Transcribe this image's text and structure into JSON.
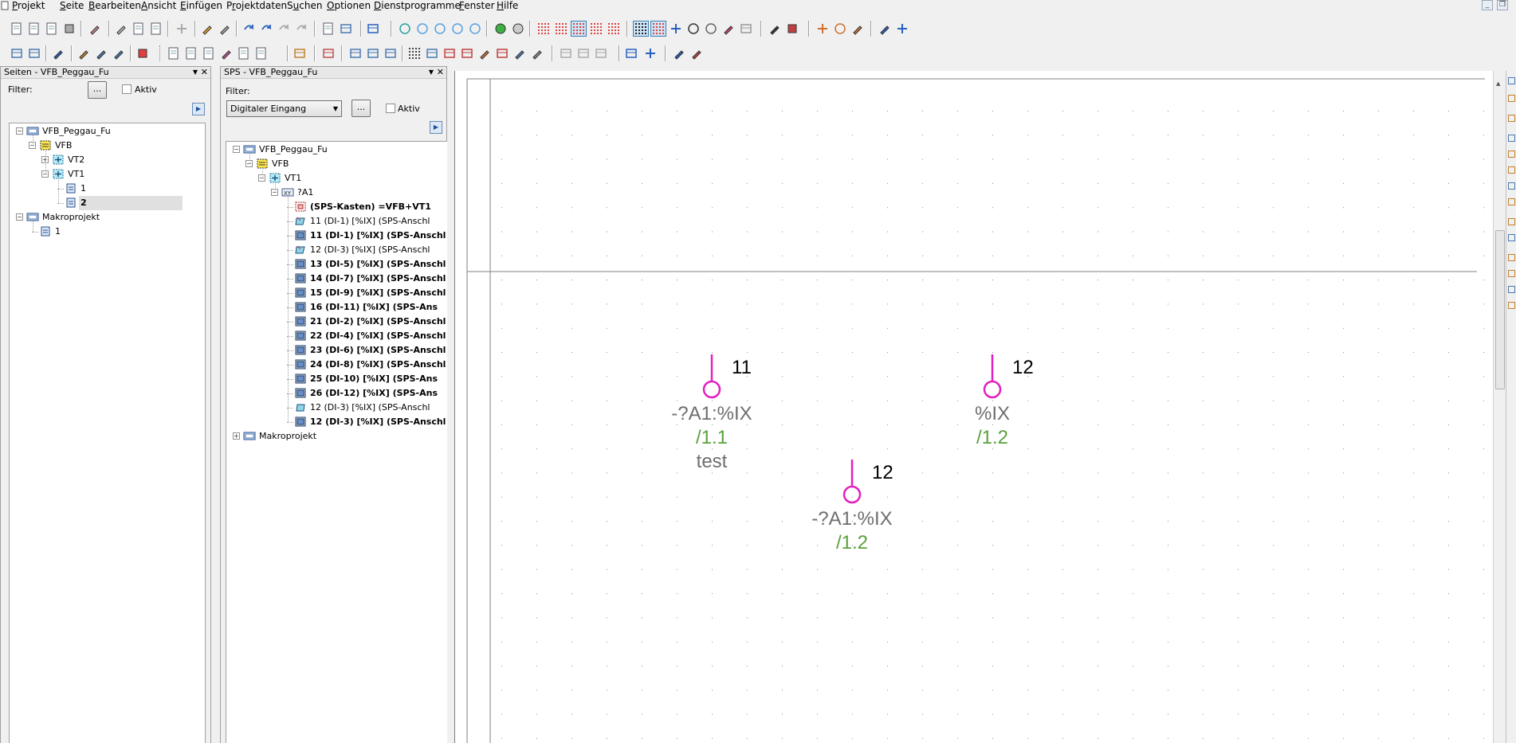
{
  "menu": {
    "items": [
      {
        "label": "Projekt",
        "ul": "P"
      },
      {
        "label": "Seite",
        "ul": "S"
      },
      {
        "label": "Bearbeiten",
        "ul": "B"
      },
      {
        "label": "Ansicht",
        "ul": "A"
      },
      {
        "label": "Einfügen",
        "ul": "E"
      },
      {
        "label": "Projektdaten",
        "ul": "r"
      },
      {
        "label": "Suchen",
        "ul": "u"
      },
      {
        "label": "Optionen",
        "ul": "O"
      },
      {
        "label": "Dienstprogramme",
        "ul": "D"
      },
      {
        "label": "Fenster",
        "ul": "F"
      },
      {
        "label": "Hilfe",
        "ul": "H"
      }
    ]
  },
  "pages_panel": {
    "title": "Seiten - VFB_Peggau_Fu",
    "filter_label": "Filter:",
    "filter_button": "...",
    "active_label": "Aktiv",
    "tree": [
      {
        "text": "VFB_Peggau_Fu",
        "level": 0,
        "expander": "−",
        "icon": "project"
      },
      {
        "text": "VFB",
        "level": 1,
        "expander": "−",
        "icon": "function"
      },
      {
        "text": "VT2",
        "level": 2,
        "expander": "+",
        "icon": "location"
      },
      {
        "text": "VT1",
        "level": 2,
        "expander": "−",
        "icon": "location"
      },
      {
        "text": "1",
        "level": 3,
        "expander": "",
        "icon": "page"
      },
      {
        "text": "2",
        "level": 3,
        "expander": "",
        "icon": "page",
        "selected": true,
        "bold": true
      },
      {
        "text": "Makroprojekt",
        "level": 0,
        "expander": "−",
        "icon": "project"
      },
      {
        "text": "1",
        "level": 1,
        "expander": "",
        "icon": "page"
      }
    ]
  },
  "sps_panel": {
    "title": "SPS - VFB_Peggau_Fu",
    "filter_label": "Filter:",
    "filter_value": "Digitaler Eingang",
    "filter_button": "...",
    "active_label": "Aktiv",
    "tree": [
      {
        "text": "VFB_Peggau_Fu",
        "level": 0,
        "expander": "−",
        "icon": "project"
      },
      {
        "text": "VFB",
        "level": 1,
        "expander": "−",
        "icon": "function"
      },
      {
        "text": "VT1",
        "level": 2,
        "expander": "−",
        "icon": "location"
      },
      {
        "text": "?A1",
        "level": 3,
        "expander": "−",
        "icon": "device"
      },
      {
        "text": "(SPS-Kasten) =VFB+VT1",
        "level": 4,
        "icon": "plcbox",
        "bold": true
      },
      {
        "text": "11 (DI-1) [%IX] (SPS-Anschl",
        "level": 4,
        "icon": "conn-open",
        "bold": false
      },
      {
        "text": "11 (DI-1) [%IX] (SPS-Anschl",
        "level": 4,
        "icon": "conn-placed",
        "bold": true
      },
      {
        "text": "12 (DI-3) [%IX] (SPS-Anschl",
        "level": 4,
        "icon": "conn-open",
        "bold": false
      },
      {
        "text": "13 (DI-5) [%IX] (SPS-Anschl",
        "level": 4,
        "icon": "conn-placed",
        "bold": true
      },
      {
        "text": "14 (DI-7) [%IX] (SPS-Anschl",
        "level": 4,
        "icon": "conn-placed",
        "bold": true
      },
      {
        "text": "15 (DI-9) [%IX] (SPS-Anschl",
        "level": 4,
        "icon": "conn-placed",
        "bold": true
      },
      {
        "text": "16 (DI-11) [%IX] (SPS-Ans",
        "level": 4,
        "icon": "conn-placed",
        "bold": true
      },
      {
        "text": "21 (DI-2) [%IX] (SPS-Anschl",
        "level": 4,
        "icon": "conn-placed",
        "bold": true
      },
      {
        "text": "22 (DI-4) [%IX] (SPS-Anschl",
        "level": 4,
        "icon": "conn-placed",
        "bold": true
      },
      {
        "text": "23 (DI-6) [%IX] (SPS-Anschl",
        "level": 4,
        "icon": "conn-placed",
        "bold": true
      },
      {
        "text": "24 (DI-8) [%IX] (SPS-Anschl",
        "level": 4,
        "icon": "conn-placed",
        "bold": true
      },
      {
        "text": "25 (DI-10) [%IX] (SPS-Ans",
        "level": 4,
        "icon": "conn-placed",
        "bold": true
      },
      {
        "text": "26 (DI-12) [%IX] (SPS-Ans",
        "level": 4,
        "icon": "conn-placed",
        "bold": true
      },
      {
        "text": "12 (DI-3) [%IX] (SPS-Anschl",
        "level": 4,
        "icon": "conn-open2",
        "bold": false
      },
      {
        "text": "12 (DI-3) [%IX] (SPS-Anschl",
        "level": 4,
        "icon": "conn-placed",
        "bold": true
      },
      {
        "text": "Makroprojekt",
        "level": 0,
        "expander": "+",
        "icon": "project"
      }
    ]
  },
  "drawing": {
    "colors": {
      "symbol": "#e020c0",
      "address": "#6e6e6e",
      "reference": "#5aa03c",
      "pin": "#000000"
    },
    "connections": [
      {
        "pin": "11",
        "address": "-?A1:%IX",
        "ref": "/1.1",
        "comment": "test"
      },
      {
        "pin": "12",
        "address": "%IX",
        "ref": "/1.2",
        "comment": ""
      },
      {
        "pin": "12",
        "address": "-?A1:%IX",
        "ref": "/1.2",
        "comment": ""
      }
    ]
  }
}
